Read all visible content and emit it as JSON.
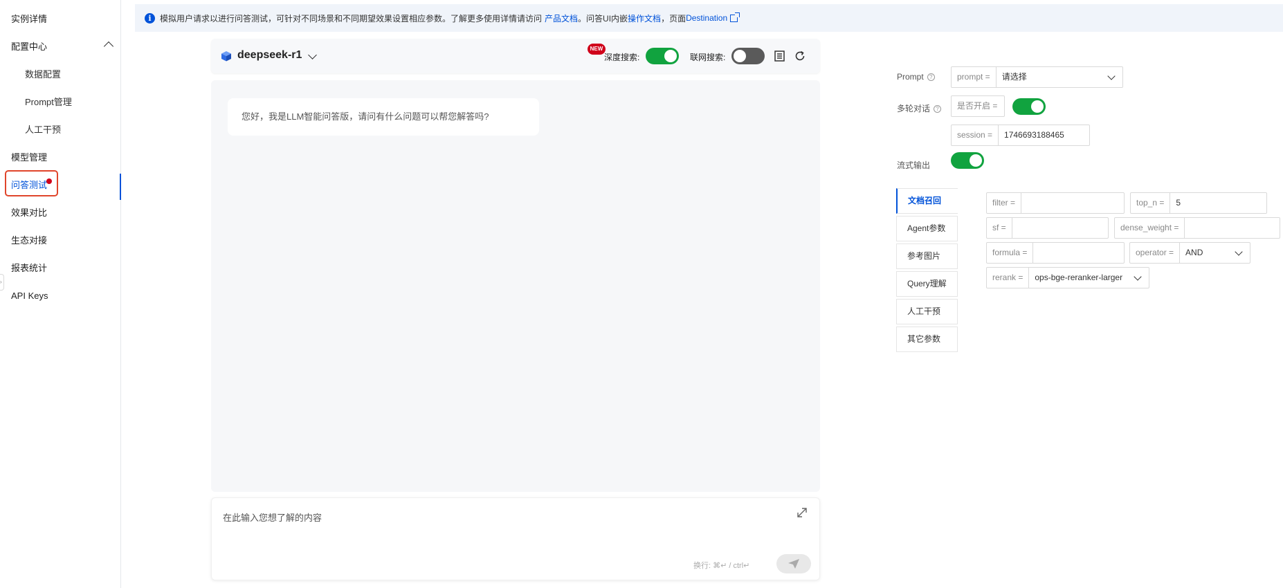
{
  "sidebar": {
    "items": [
      {
        "label": "实例详情"
      },
      {
        "label": "配置中心"
      },
      {
        "label": "数据配置"
      },
      {
        "label": "Prompt管理"
      },
      {
        "label": "人工干预"
      },
      {
        "label": "模型管理"
      },
      {
        "label": "问答测试"
      },
      {
        "label": "效果对比"
      },
      {
        "label": "生态对接"
      },
      {
        "label": "报表统计"
      },
      {
        "label": "API Keys"
      }
    ],
    "active_item": "问答测试",
    "collapse_glyph": "›"
  },
  "banner": {
    "info_glyph": "i",
    "text1": "模拟用户请求以进行问答测试，可针对不同场景和不同期望效果设置相应参数。了解更多使用详情请访问",
    "link1": "产品文档",
    "text2": "。问答UI内嵌",
    "link2": "操作文档",
    "text3": "，页面",
    "link3": "Destination"
  },
  "chat": {
    "model_name": "deepseek-r1",
    "new_badge": "NEW",
    "deep_search_label": "深度搜索:",
    "deep_search_on": true,
    "web_search_label": "联网搜索:",
    "web_search_on": false,
    "greeting": "您好，我是LLM智能问答版，请问有什么问题可以帮您解答吗?",
    "input_placeholder": "在此输入您想了解的内容",
    "hint": "换行: ⌘↵ / ctrl↵"
  },
  "params": {
    "prompt_label": "Prompt",
    "prompt_prefix": "prompt =",
    "prompt_value": "请选择",
    "multi_turn_label": "多轮对话",
    "multi_turn_prefix": "是否开启 =",
    "multi_turn_on": true,
    "session_prefix": "session =",
    "session_value": "1746693188465",
    "stream_label": "流式输出",
    "stream_on": true,
    "help_glyph": "?"
  },
  "tabs": [
    {
      "label": "文档召回"
    },
    {
      "label": "Agent参数"
    },
    {
      "label": "参考图片"
    },
    {
      "label": "Query理解"
    },
    {
      "label": "人工干预"
    },
    {
      "label": "其它参数"
    }
  ],
  "retrieval": {
    "filter_prefix": "filter =",
    "filter_value": "",
    "top_n_prefix": "top_n =",
    "top_n_value": "5",
    "sf_prefix": "sf =",
    "sf_value": "",
    "dense_weight_prefix": "dense_weight =",
    "dense_weight_value": "",
    "formula_prefix": "formula =",
    "formula_value": "",
    "operator_prefix": "operator =",
    "operator_value": "AND",
    "rerank_prefix": "rerank =",
    "rerank_value": "ops-bge-reranker-larger"
  },
  "colors": {
    "accent": "#0052d9",
    "toggle_on": "#11a33f",
    "toggle_off": "#5a5a5a",
    "highlight_box": "#e0452b"
  }
}
